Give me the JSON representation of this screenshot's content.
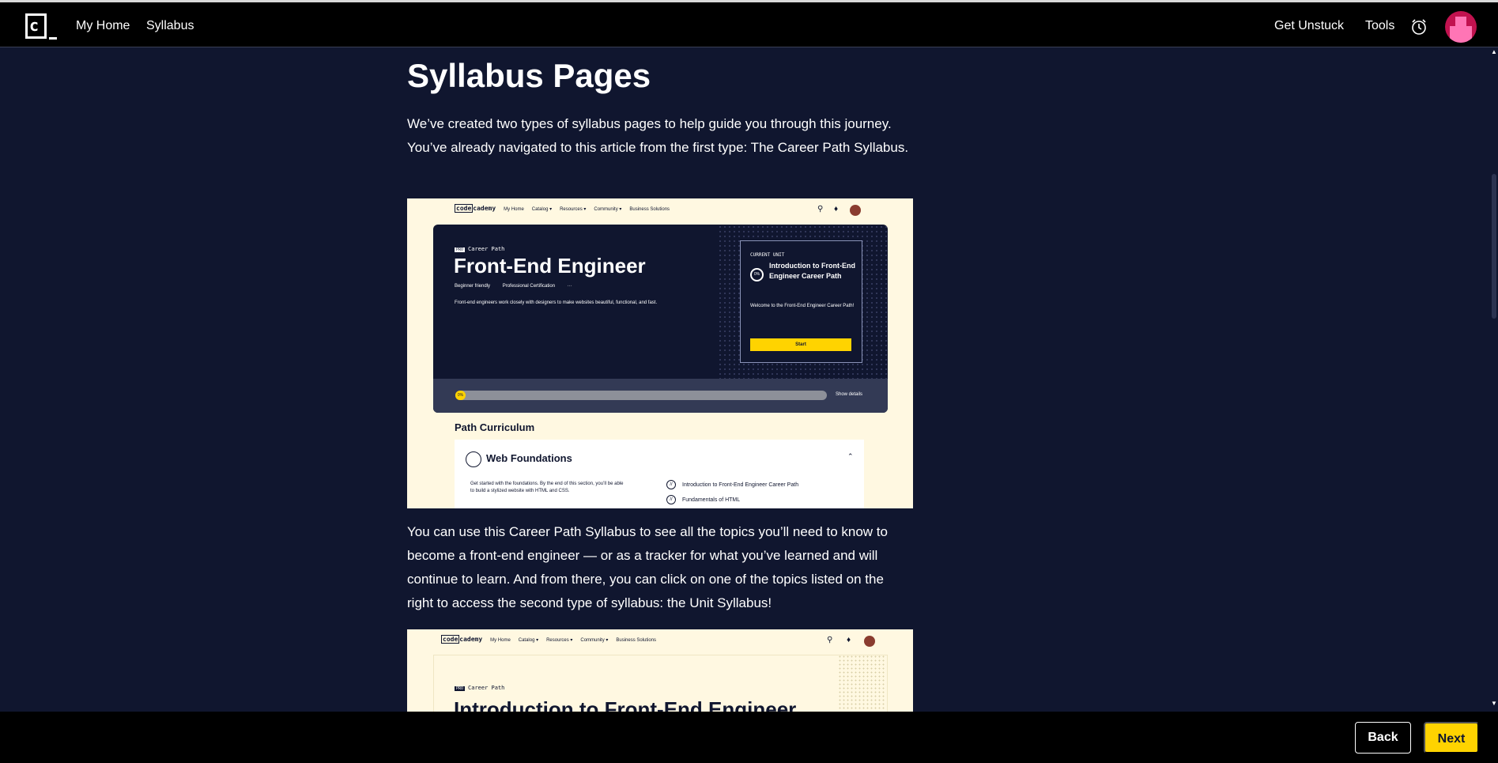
{
  "nav": {
    "logo_text": "c",
    "my_home": "My Home",
    "syllabus": "Syllabus",
    "get_unstuck": "Get Unstuck",
    "tools": "Tools"
  },
  "article": {
    "title": "Syllabus Pages",
    "para1": "We’ve created two types of syllabus pages to help guide you through this journey. You’ve already navigated to this article from the first type: The Career Path Syllabus.",
    "para2": "You can use this Career Path Syllabus to see all the topics you’ll need to know to become a front-end engineer — or as a tracker for what you’ve learned and will continue to learn. And from there, you can click on one of the topics listed on the right to access the second type of syllabus: the Unit Syllabus!"
  },
  "screenshot1": {
    "logo_left": "code",
    "logo_right": "cademy",
    "nav_items": [
      "My Home",
      "Catalog ▾",
      "Resources ▾",
      "Community ▾",
      "Business Solutions"
    ],
    "pro": "PRO",
    "label": "Career Path",
    "title": "Front-End Engineer",
    "meta_1": "Beginner friendly",
    "meta_2": "Professional Certification",
    "meta_3": "···",
    "description": "Front-end engineers work closely with designers to make websites beautiful, functional, and fast.",
    "current_unit_label": "CURRENT UNIT",
    "unit_progress": "0%",
    "unit_title": "Introduction to Front-End Engineer Career Path",
    "unit_welcome": "Welcome to the Front-End Engineer Career Path!",
    "start": "Start",
    "progress_label": "0%",
    "show_details": "Show details",
    "curriculum_title": "Path Curriculum",
    "section_title": "Web Foundations",
    "section_desc": "Get started with the foundations. By the end of this section, you’ll be able to build a stylized website with HTML and CSS.",
    "lessons": [
      "Introduction to Front-End Engineer Career Path",
      "Fundamentals of HTML"
    ]
  },
  "screenshot2": {
    "logo_left": "code",
    "logo_right": "cademy",
    "nav_items": [
      "My Home",
      "Catalog ▾",
      "Resources ▾",
      "Community ▾",
      "Business Solutions"
    ],
    "pro": "PRO",
    "label": "Career Path",
    "title": "Introduction to Front-End Engineer"
  },
  "footer": {
    "back": "Back",
    "next": "Next"
  },
  "icons": {
    "alarm": "alarm-clock-icon",
    "avatar": "avatar"
  },
  "colors": {
    "background": "#10162f",
    "accent": "#ffd300",
    "avatar": "#c1124f"
  }
}
